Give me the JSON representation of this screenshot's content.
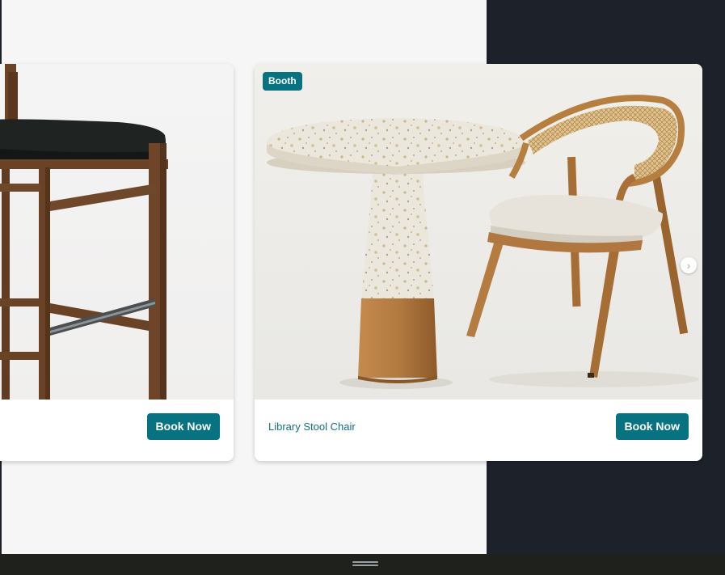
{
  "carousel": {
    "cards": [
      {
        "product_name": "",
        "button_label": "Book Now",
        "image_icon": "bar-stool-image"
      },
      {
        "badge": "Booth",
        "product_name": "Library Stool Chair",
        "button_label": "Book Now",
        "image_icon": "table-and-chair-image"
      }
    ],
    "next_icon": "›"
  },
  "colors": {
    "accent": "#087380",
    "panel_dark": "#1d2129",
    "page_bg": "#f6f6f6",
    "bottom_bar": "#1f211d"
  }
}
